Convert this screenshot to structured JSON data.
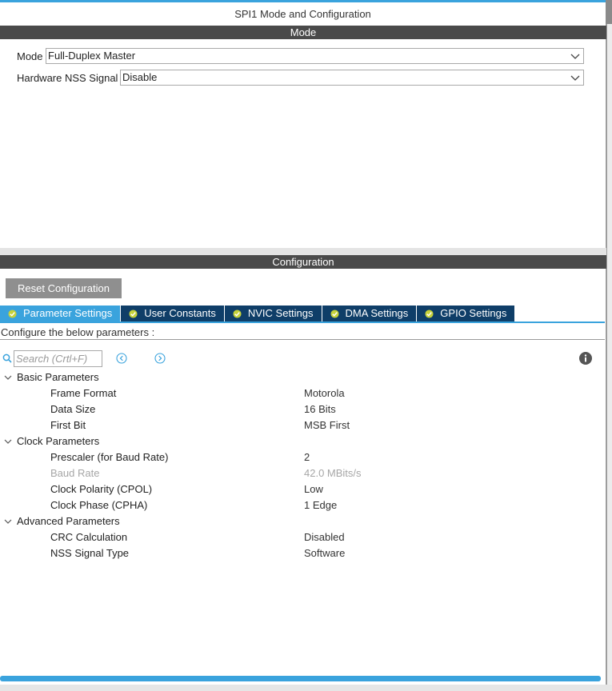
{
  "window": {
    "title": "SPI1 Mode and Configuration"
  },
  "mode_section": {
    "header": "Mode",
    "fields": [
      {
        "label": "Mode",
        "value": "Full-Duplex Master"
      },
      {
        "label": "Hardware NSS Signal",
        "value": "Disable"
      }
    ]
  },
  "config_section": {
    "header": "Configuration",
    "reset_label": "Reset Configuration",
    "tabs": [
      {
        "label": "Parameter Settings"
      },
      {
        "label": "User Constants"
      },
      {
        "label": "NVIC Settings"
      },
      {
        "label": "DMA Settings"
      },
      {
        "label": "GPIO Settings"
      }
    ],
    "configure_text": "Configure the below parameters :",
    "search": {
      "placeholder": "Search (Crtl+F)"
    },
    "groups": [
      {
        "label": "Basic Parameters",
        "params": [
          {
            "name": "Frame Format",
            "value": "Motorola"
          },
          {
            "name": "Data Size",
            "value": "16 Bits"
          },
          {
            "name": "First Bit",
            "value": "MSB First"
          }
        ]
      },
      {
        "label": "Clock Parameters",
        "params": [
          {
            "name": "Prescaler (for Baud Rate)",
            "value": "2"
          },
          {
            "name": "Baud Rate",
            "value": "42.0 MBits/s"
          },
          {
            "name": "Clock Polarity (CPOL)",
            "value": "Low"
          },
          {
            "name": "Clock Phase (CPHA)",
            "value": "1 Edge"
          }
        ]
      },
      {
        "label": "Advanced Parameters",
        "params": [
          {
            "name": "CRC Calculation",
            "value": "Disabled"
          },
          {
            "name": "NSS Signal Type",
            "value": "Software"
          }
        ]
      }
    ]
  },
  "icons": {
    "select_chevron": "chevron-down-icon",
    "tab_check": "check-circle-icon",
    "search": "search-icon",
    "nav_prev": "chevron-left-circle-icon",
    "nav_next": "chevron-right-circle-icon",
    "info": "info-icon",
    "group_toggle": "chevron-down-icon"
  },
  "colors": {
    "accent": "#3aa3dd",
    "header_bar": "#4a4a4a",
    "tab_inactive": "#0f3e68",
    "reset_button": "#8f8f8f",
    "check_icon": "#c6d23a",
    "disabled_text": "#a6a6a6"
  }
}
